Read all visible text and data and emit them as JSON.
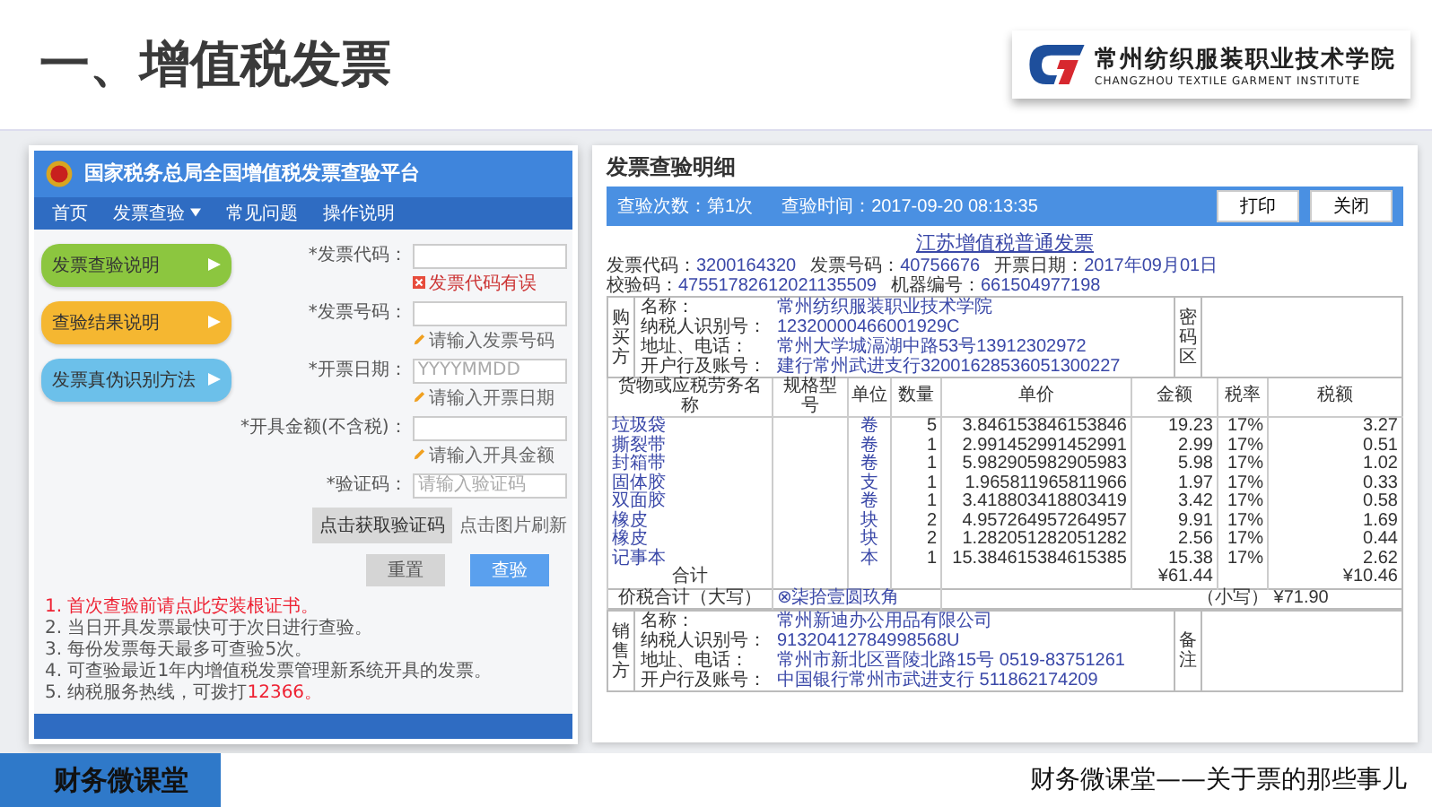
{
  "slide": {
    "title": "一、增值税发票"
  },
  "logo": {
    "name_cn": "常州纺织服装职业技术学院",
    "name_en": "CHANGZHOU TEXTILE GARMENT INSTITUTE"
  },
  "platform": {
    "title": "国家税务总局全国增值税发票查验平台",
    "nav": [
      {
        "label": "首页",
        "dropdown": false
      },
      {
        "label": "发票查验",
        "dropdown": true
      },
      {
        "label": "常见问题",
        "dropdown": false
      },
      {
        "label": "操作说明",
        "dropdown": false
      }
    ],
    "guide_buttons": [
      {
        "label": "发票查验说明",
        "color": "#8cc63f"
      },
      {
        "label": "查验结果说明",
        "color": "#f5b731"
      },
      {
        "label": "发票真伪识别方法",
        "color": "#6cc0ea"
      }
    ],
    "fields": [
      {
        "label": "*发票代码：",
        "hint": "发票代码有误",
        "kind": "error"
      },
      {
        "label": "*发票号码：",
        "hint": "请输入发票号码",
        "kind": "edit"
      },
      {
        "label": "*开票日期：",
        "placeholder": "YYYYMMDD",
        "hint": "请输入开票日期",
        "kind": "edit"
      },
      {
        "label": "*开具金额(不含税)：",
        "hint": "请输入开具金额",
        "kind": "edit"
      },
      {
        "label": "*验证码：",
        "placeholder": "请输入验证码"
      }
    ],
    "captcha_button": "点击获取验证码",
    "captcha_hint": "点击图片刷新",
    "actions": [
      {
        "label": "重置",
        "kind": "reset"
      },
      {
        "label": "查验",
        "kind": "submit"
      }
    ],
    "notes": [
      {
        "text": "1. 首次查验前请点此安装根证书。",
        "emphasis": true
      },
      {
        "text": "2. 当日开具发票最快可于次日进行查验。",
        "emphasis": false
      },
      {
        "text": "3. 每份发票每天最多可查验5次。",
        "emphasis": false
      },
      {
        "text": "4. 可查验最近1年内增值税发票管理新系统开具的发票。",
        "emphasis": false
      },
      {
        "text": "5. 纳税服务热线，可拨打",
        "number": "12366。",
        "emphasis": false
      }
    ]
  },
  "invoice_detail": {
    "heading": "发票查验明细",
    "check_count": "查验次数：第1次",
    "check_time": "查验时间：2017-09-20 08:13:35",
    "buttons": [
      "打印",
      "关闭"
    ],
    "invoice_title": "江苏增值税普通发票",
    "meta": [
      {
        "label": "发票代码：",
        "value": "3200164320"
      },
      {
        "label": "发票号码：",
        "value": "40756676"
      },
      {
        "label": "开票日期：",
        "value": "2017年09月01日"
      },
      {
        "label": "校验码：",
        "value": "47551782612021135509"
      },
      {
        "label": "机器编号：",
        "value": "661504977198"
      }
    ],
    "buyer": {
      "label": "购买方",
      "rows": [
        {
          "label": "名称：",
          "value": "常州纺织服装职业技术学院"
        },
        {
          "label": "纳税人识别号：",
          "value": "12320000466001929C"
        },
        {
          "label": "地址、电话：",
          "value": "常州大学城滆湖中路53号13912302972"
        },
        {
          "label": "开户行及账号：",
          "value": "建行常州武进支行32001628536051300227"
        }
      ]
    },
    "cipher_label": "密码区",
    "columns": [
      "货物或应税劳务名称",
      "规格型号",
      "单位",
      "数量",
      "单价",
      "金额",
      "税率",
      "税额"
    ],
    "items": [
      {
        "name": "垃圾袋",
        "unit": "卷",
        "quantity": "5",
        "unit_price": "3.846153846153846",
        "amount": "19.23",
        "tax_rate": "17%",
        "tax": "3.27"
      },
      {
        "name": "撕裂带",
        "unit": "卷",
        "quantity": "1",
        "unit_price": "2.991452991452991",
        "amount": "2.99",
        "tax_rate": "17%",
        "tax": "0.51"
      },
      {
        "name": "封箱带",
        "unit": "卷",
        "quantity": "1",
        "unit_price": "5.982905982905983",
        "amount": "5.98",
        "tax_rate": "17%",
        "tax": "1.02"
      },
      {
        "name": "固体胶",
        "unit": "支",
        "quantity": "1",
        "unit_price": "1.965811965811966",
        "amount": "1.97",
        "tax_rate": "17%",
        "tax": "0.33"
      },
      {
        "name": "双面胶",
        "unit": "卷",
        "quantity": "1",
        "unit_price": "3.418803418803419",
        "amount": "3.42",
        "tax_rate": "17%",
        "tax": "0.58"
      },
      {
        "name": "橡皮",
        "unit": "块",
        "quantity": "2",
        "unit_price": "4.957264957264957",
        "amount": "9.91",
        "tax_rate": "17%",
        "tax": "1.69"
      },
      {
        "name": "橡皮",
        "unit": "块",
        "quantity": "2",
        "unit_price": "1.282051282051282",
        "amount": "2.56",
        "tax_rate": "17%",
        "tax": "0.44"
      },
      {
        "name": "记事本",
        "unit": "本",
        "quantity": "1",
        "unit_price": "15.384615384615385",
        "amount": "15.38",
        "tax_rate": "17%",
        "tax": "2.62"
      }
    ],
    "total": {
      "label": "合计",
      "amount": "¥61.44",
      "tax": "¥10.46"
    },
    "grand_total": {
      "label": "价税合计（大写）",
      "words": "⊗柒拾壹圆玖角",
      "small_label": "（小写）",
      "value": "¥71.90"
    },
    "seller": {
      "label": "销售方",
      "rows": [
        {
          "label": "名称：",
          "value": "常州新迪办公用品有限公司"
        },
        {
          "label": "纳税人识别号：",
          "value": "91320412784998568U"
        },
        {
          "label": "地址、电话：",
          "value": "常州市新北区晋陵北路15号 0519-83751261"
        },
        {
          "label": "开户行及账号：",
          "value": "中国银行常州市武进支行 511862174209"
        }
      ]
    },
    "remarks_label": "备注"
  },
  "footer": {
    "badge": "财务微课堂",
    "caption": "财务微课堂——关于票的那些事儿"
  }
}
